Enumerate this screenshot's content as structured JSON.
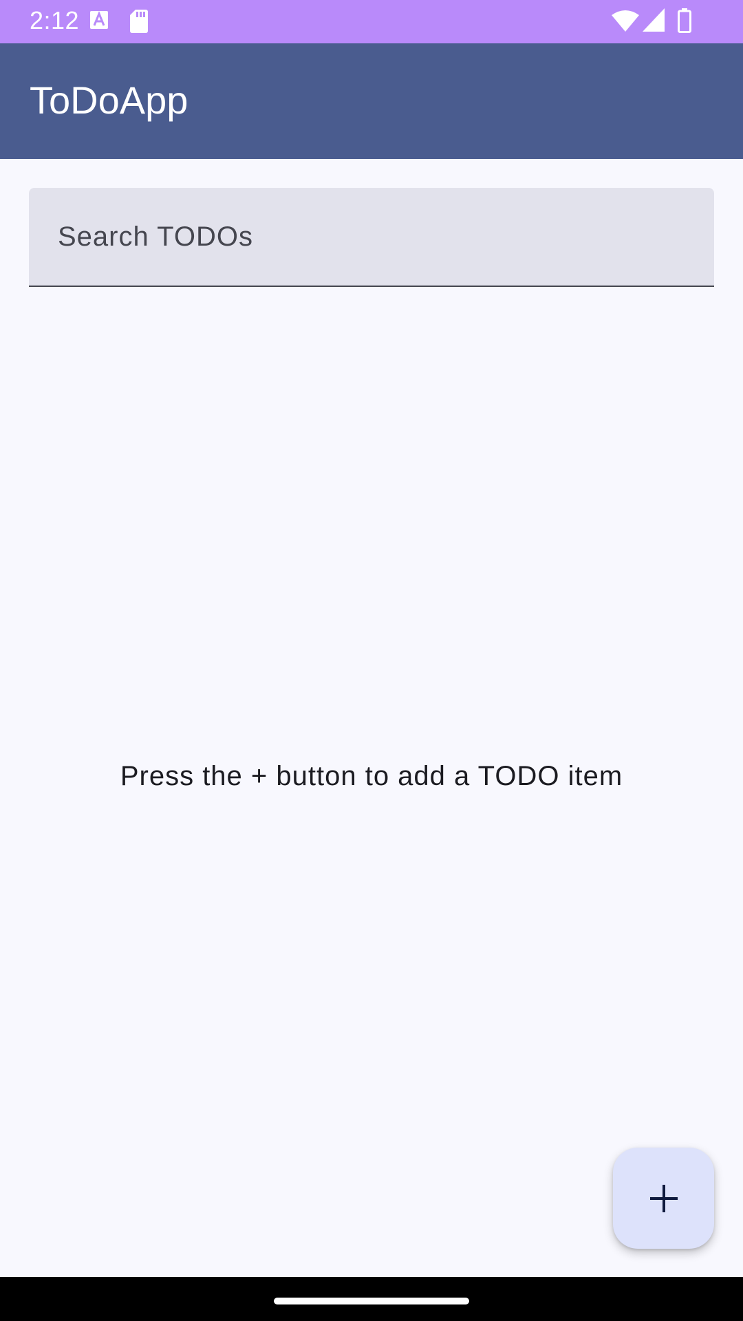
{
  "status_bar": {
    "time": "2:12",
    "icons": [
      "a-keyboard-icon",
      "sd-card-icon",
      "wifi-icon",
      "cell-signal-icon",
      "battery-icon"
    ],
    "background_color": "#b98afa"
  },
  "app_bar": {
    "title": "ToDoApp",
    "background_color": "#4a5c8f"
  },
  "search": {
    "placeholder": "Search TODOs",
    "value": ""
  },
  "empty_state": {
    "message": "Press the + button to add a TODO item"
  },
  "fab": {
    "label": "+",
    "icon": "plus-icon",
    "background_color": "#dde2fb"
  },
  "nav_bar": {
    "handle": "home-gesture-handle"
  }
}
